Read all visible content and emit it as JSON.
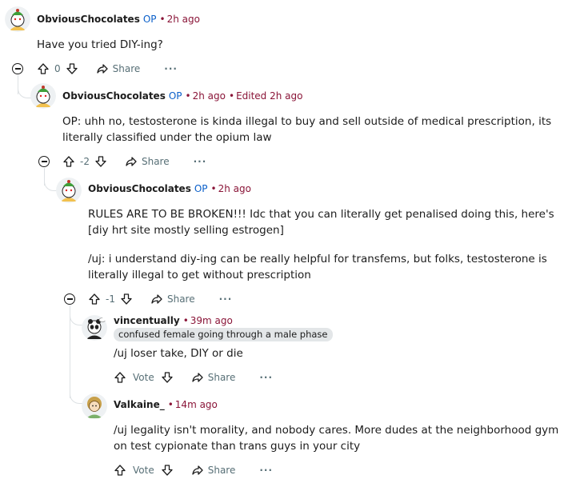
{
  "comments": [
    {
      "author": "ObviousChocolates",
      "op_badge": "OP",
      "time": "2h ago",
      "body": [
        "Have you tried DIY-ing?"
      ],
      "score": "0",
      "share_label": "Share",
      "more_label": "···"
    },
    {
      "author": "ObviousChocolates",
      "op_badge": "OP",
      "time": "2h ago",
      "edited": "Edited 2h ago",
      "body": [
        "OP: uhh no, testosterone is kinda illegal to buy and sell outside of medical prescription, its literally classified under the opium law"
      ],
      "score": "-2",
      "share_label": "Share",
      "more_label": "···"
    },
    {
      "author": "ObviousChocolates",
      "op_badge": "OP",
      "time": "2h ago",
      "body": [
        "RULES ARE TO BE BROKEN!!! Idc that you can literally get penalised doing this, here's [diy hrt site mostly selling estrogen]",
        "/uj: i understand diy-ing can be really helpful for transfems, but folks, testosterone is literally illegal to get without prescription"
      ],
      "score": "-1",
      "share_label": "Share",
      "more_label": "···"
    },
    {
      "author": "vincentually",
      "time": "39m ago",
      "flair": "confused female going through a male phase",
      "body": [
        "/uj loser take, DIY or die"
      ],
      "score": "Vote",
      "share_label": "Share",
      "more_label": "···"
    },
    {
      "author": "Valkaine_",
      "time": "14m ago",
      "body": [
        "/uj legality isn't morality, and nobody cares. More dudes at the neighborhood gym on test cypionate than trans guys in your city"
      ],
      "score": "Vote",
      "share_label": "Share",
      "more_label": "···"
    }
  ],
  "colors": {
    "accent_op": "#0a5fc9",
    "timestamp": "#8a1538",
    "action_text": "#576f76",
    "thread_line": "#dde1e4"
  }
}
